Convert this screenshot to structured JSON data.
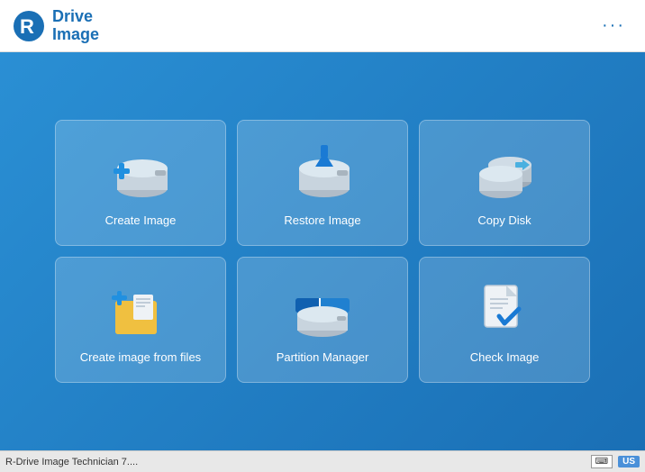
{
  "header": {
    "title_line1": "Drive",
    "title_line2": "Image",
    "menu_dots": "···"
  },
  "tiles": [
    {
      "id": "create-image",
      "label": "Create Image"
    },
    {
      "id": "restore-image",
      "label": "Restore Image"
    },
    {
      "id": "copy-disk",
      "label": "Copy Disk"
    },
    {
      "id": "create-image-files",
      "label": "Create image from files"
    },
    {
      "id": "partition-manager",
      "label": "Partition Manager"
    },
    {
      "id": "check-image",
      "label": "Check Image"
    }
  ],
  "statusbar": {
    "app_name": "R-Drive Image Technician 7....",
    "lang": "US"
  }
}
